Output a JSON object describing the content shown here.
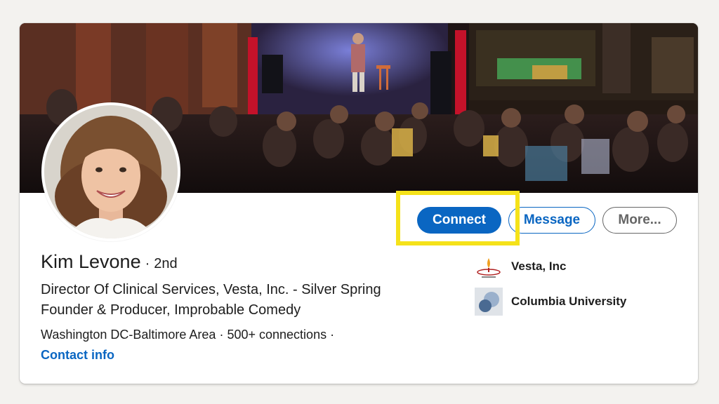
{
  "profile": {
    "name": "Kim Levone",
    "degree_sep": "·",
    "degree": "2nd",
    "headline_1": "Director Of Clinical Services, Vesta, Inc. - Silver Spring",
    "headline_2": "Founder & Producer, Improbable Comedy",
    "location": "Washington DC-Baltimore Area",
    "sep": "·",
    "connections": "500+ connections",
    "sep2": "·",
    "contact_info": "Contact info"
  },
  "actions": {
    "connect": "Connect",
    "message": "Message",
    "more": "More..."
  },
  "orgs": [
    {
      "name": "Vesta, Inc",
      "icon": "vesta-logo-icon"
    },
    {
      "name": "Columbia University",
      "icon": "columbia-logo-icon"
    }
  ],
  "colors": {
    "primary": "#0a66c2",
    "highlight": "#f5e21a"
  }
}
